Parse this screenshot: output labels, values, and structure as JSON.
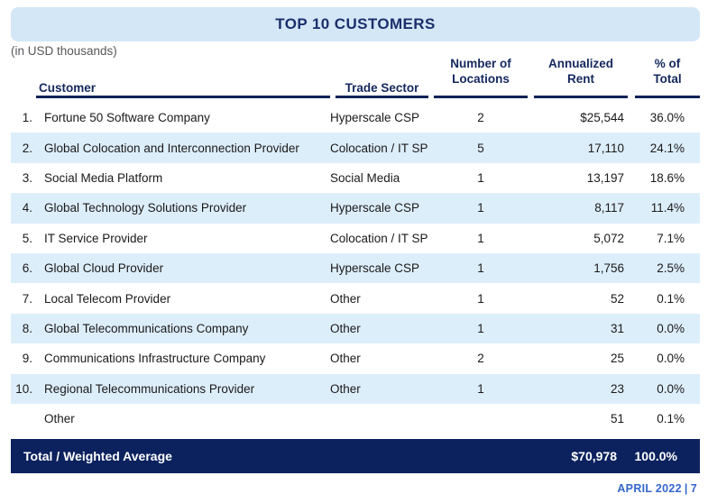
{
  "slide": {
    "title": "TOP 10 CUSTOMERS",
    "units_note": "(in USD thousands)",
    "colors": {
      "title_bar_bg": "#d4e7f7",
      "title_text": "#1a2f6b",
      "row_alt_bg": "#ddeefb",
      "total_bar_bg": "#0b225e",
      "rule": "#0d2357",
      "footer_text": "#3366cc"
    }
  },
  "table": {
    "headers": {
      "customer": "Customer",
      "trade_sector": "Trade Sector",
      "locations_line1": "Number of",
      "locations_line2": "Locations",
      "rent_line1": "Annualized",
      "rent_line2": "Rent",
      "pct_line1": "% of",
      "pct_line2": "Total"
    },
    "rows": [
      {
        "rank": "1.",
        "customer": "Fortune 50 Software Company",
        "sector": "Hyperscale CSP",
        "locations": "2",
        "rent": "$25,544",
        "pct": "36.0%"
      },
      {
        "rank": "2.",
        "customer": "Global Colocation and Interconnection Provider",
        "sector": "Colocation / IT SP",
        "locations": "5",
        "rent": "17,110",
        "pct": "24.1%"
      },
      {
        "rank": "3.",
        "customer": "Social Media Platform",
        "sector": "Social Media",
        "locations": "1",
        "rent": "13,197",
        "pct": "18.6%"
      },
      {
        "rank": "4.",
        "customer": "Global Technology Solutions Provider",
        "sector": "Hyperscale CSP",
        "locations": "1",
        "rent": "8,117",
        "pct": "11.4%"
      },
      {
        "rank": "5.",
        "customer": "IT Service Provider",
        "sector": "Colocation / IT SP",
        "locations": "1",
        "rent": "5,072",
        "pct": "7.1%"
      },
      {
        "rank": "6.",
        "customer": "Global Cloud Provider",
        "sector": "Hyperscale CSP",
        "locations": "1",
        "rent": "1,756",
        "pct": "2.5%"
      },
      {
        "rank": "7.",
        "customer": "Local Telecom Provider",
        "sector": "Other",
        "locations": "1",
        "rent": "52",
        "pct": "0.1%"
      },
      {
        "rank": "8.",
        "customer": "Global Telecommunications Company",
        "sector": "Other",
        "locations": "1",
        "rent": "31",
        "pct": "0.0%"
      },
      {
        "rank": "9.",
        "customer": "Communications Infrastructure Company",
        "sector": "Other",
        "locations": "2",
        "rent": "25",
        "pct": "0.0%"
      },
      {
        "rank": "10.",
        "customer": "Regional Telecommunications Provider",
        "sector": "Other",
        "locations": "1",
        "rent": "23",
        "pct": "0.0%"
      },
      {
        "rank": "",
        "customer": "Other",
        "sector": "",
        "locations": "",
        "rent": "51",
        "pct": "0.1%"
      }
    ],
    "total": {
      "label": "Total / Weighted Average",
      "locations": "",
      "rent": "$70,978",
      "pct": "100.0%"
    }
  },
  "footer": {
    "date": "APRIL 2022",
    "separator": "|",
    "page": "7"
  }
}
